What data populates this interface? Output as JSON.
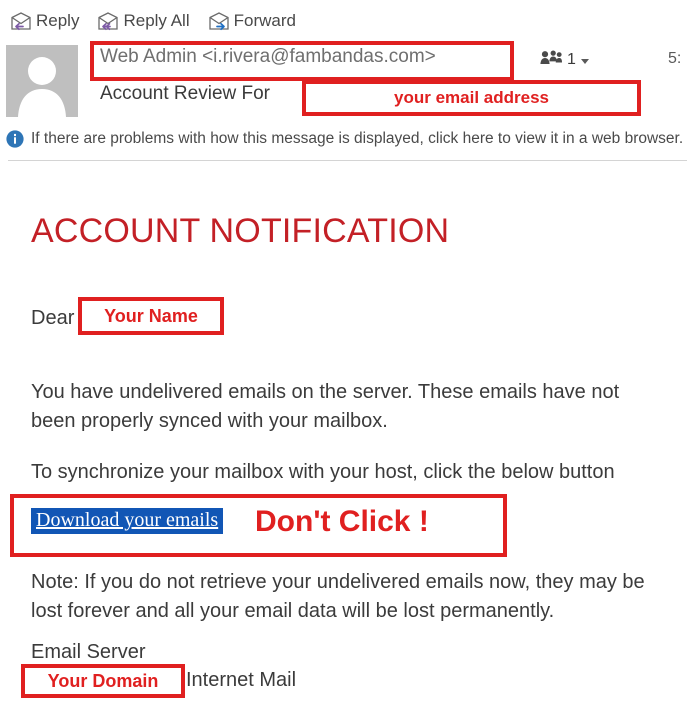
{
  "toolbar": {
    "buttons": [
      {
        "label": "Reply",
        "icon": "reply-envelope-icon",
        "arrow_color": "#7d5ba6"
      },
      {
        "label": "Reply All",
        "icon": "reply-all-envelope-icon",
        "arrow_color": "#7d5ba6"
      },
      {
        "label": "Forward",
        "icon": "forward-envelope-icon",
        "arrow_color": "#1f6fc4"
      }
    ]
  },
  "header": {
    "avatar_icon": "default-person-avatar",
    "sender": "Web Admin <i.rivera@fambandas.com>",
    "subject": "Account Review For",
    "recipients_icon": "people-icon",
    "recipients_count": "1",
    "recipients_caret": "chevron-down-icon",
    "timestamp": "5:"
  },
  "infobar": {
    "icon": "info-circle-icon",
    "text": "If there are problems with how this message is displayed, click here to view it in a web browser."
  },
  "mail": {
    "title": "ACCOUNT NOTIFICATION",
    "greeting": "Dear",
    "paragraph_1": "You have undelivered emails on the server. These emails have not been properly synced with your mailbox.",
    "paragraph_2": "To synchronize your mailbox with your host, click the below button",
    "download_button": "Download your emails",
    "note": "Note: If you do not retrieve your undelivered emails now, they may be lost forever and all your email data will be lost permanently.",
    "signature_line_1": "Email Server",
    "signature_line_2": "Internet Mail"
  },
  "annotations": {
    "sender_box": "",
    "subject_box": "your email address",
    "your_name_box": "Your Name",
    "dont_click_box": "",
    "dont_click_text": "Don't Click !",
    "your_domain_box": "Your Domain"
  },
  "colors": {
    "annotation_red": "#e02020",
    "title_red": "#c32026",
    "link_button_blue": "#1156b5",
    "info_blue": "#2e75b6"
  }
}
